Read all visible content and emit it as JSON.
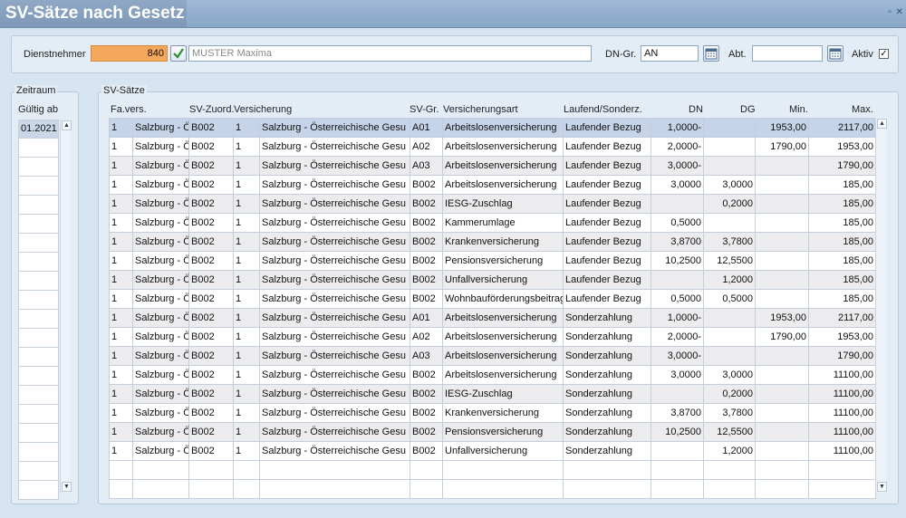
{
  "window": {
    "title": "SV-Sätze nach Gesetz",
    "controls": [
      "▫",
      "✕"
    ]
  },
  "header": {
    "employee_label": "Dienstnehmer",
    "employee_number": "840",
    "employee_name": "MUSTER Maxima",
    "dn_group_label": "DN-Gr.",
    "dn_group_value": "AN",
    "abt_label": "Abt.",
    "abt_value": "",
    "aktiv_label": "Aktiv",
    "aktiv_checked": "✓"
  },
  "zeitraum": {
    "group_label": "Zeitraum",
    "column_header": "Gültig ab",
    "rows": [
      "01.2021",
      "",
      "",
      "",
      "",
      "",
      "",
      "",
      "",
      "",
      "",
      "",
      "",
      "",
      "",
      "",
      "",
      "",
      "",
      ""
    ]
  },
  "sv": {
    "group_label": "SV-Sätze",
    "columns": [
      "Fa.vers.",
      "SV-Zuord.",
      "Versicherung",
      "SV-Gr.",
      "Versicherungsart",
      "Laufend/Sonderz.",
      "DN",
      "DG",
      "Min.",
      "Max."
    ],
    "rows": [
      [
        "1",
        "Salzburg - Öste",
        "B002",
        "1",
        "Salzburg - Österreichische Gesu",
        "A01",
        "Arbeitslosenversicherung",
        "Laufender Bezug",
        "1,0000-",
        "",
        "1953,00",
        "2117,00"
      ],
      [
        "1",
        "Salzburg - Öste",
        "B002",
        "1",
        "Salzburg - Österreichische Gesu",
        "A02",
        "Arbeitslosenversicherung",
        "Laufender Bezug",
        "2,0000-",
        "",
        "1790,00",
        "1953,00"
      ],
      [
        "1",
        "Salzburg - Öste",
        "B002",
        "1",
        "Salzburg - Österreichische Gesu",
        "A03",
        "Arbeitslosenversicherung",
        "Laufender Bezug",
        "3,0000-",
        "",
        "",
        "1790,00"
      ],
      [
        "1",
        "Salzburg - Öste",
        "B002",
        "1",
        "Salzburg - Österreichische Gesu",
        "B002",
        "Arbeitslosenversicherung",
        "Laufender Bezug",
        "3,0000",
        "3,0000",
        "",
        "185,00"
      ],
      [
        "1",
        "Salzburg - Öste",
        "B002",
        "1",
        "Salzburg - Österreichische Gesu",
        "B002",
        "IESG-Zuschlag",
        "Laufender Bezug",
        "",
        "0,2000",
        "",
        "185,00"
      ],
      [
        "1",
        "Salzburg - Öste",
        "B002",
        "1",
        "Salzburg - Österreichische Gesu",
        "B002",
        "Kammerumlage",
        "Laufender Bezug",
        "0,5000",
        "",
        "",
        "185,00"
      ],
      [
        "1",
        "Salzburg - Öste",
        "B002",
        "1",
        "Salzburg - Österreichische Gesu",
        "B002",
        "Krankenversicherung",
        "Laufender Bezug",
        "3,8700",
        "3,7800",
        "",
        "185,00"
      ],
      [
        "1",
        "Salzburg - Öste",
        "B002",
        "1",
        "Salzburg - Österreichische Gesu",
        "B002",
        "Pensionsversicherung",
        "Laufender Bezug",
        "10,2500",
        "12,5500",
        "",
        "185,00"
      ],
      [
        "1",
        "Salzburg - Öste",
        "B002",
        "1",
        "Salzburg - Österreichische Gesu",
        "B002",
        "Unfallversicherung",
        "Laufender Bezug",
        "",
        "1,2000",
        "",
        "185,00"
      ],
      [
        "1",
        "Salzburg - Öste",
        "B002",
        "1",
        "Salzburg - Österreichische Gesu",
        "B002",
        "Wohnbauförderungsbeitrag",
        "Laufender Bezug",
        "0,5000",
        "0,5000",
        "",
        "185,00"
      ],
      [
        "1",
        "Salzburg - Öste",
        "B002",
        "1",
        "Salzburg - Österreichische Gesu",
        "A01",
        "Arbeitslosenversicherung",
        "Sonderzahlung",
        "1,0000-",
        "",
        "1953,00",
        "2117,00"
      ],
      [
        "1",
        "Salzburg - Öste",
        "B002",
        "1",
        "Salzburg - Österreichische Gesu",
        "A02",
        "Arbeitslosenversicherung",
        "Sonderzahlung",
        "2,0000-",
        "",
        "1790,00",
        "1953,00"
      ],
      [
        "1",
        "Salzburg - Öste",
        "B002",
        "1",
        "Salzburg - Österreichische Gesu",
        "A03",
        "Arbeitslosenversicherung",
        "Sonderzahlung",
        "3,0000-",
        "",
        "",
        "1790,00"
      ],
      [
        "1",
        "Salzburg - Öste",
        "B002",
        "1",
        "Salzburg - Österreichische Gesu",
        "B002",
        "Arbeitslosenversicherung",
        "Sonderzahlung",
        "3,0000",
        "3,0000",
        "",
        "11100,00"
      ],
      [
        "1",
        "Salzburg - Öste",
        "B002",
        "1",
        "Salzburg - Österreichische Gesu",
        "B002",
        "IESG-Zuschlag",
        "Sonderzahlung",
        "",
        "0,2000",
        "",
        "11100,00"
      ],
      [
        "1",
        "Salzburg - Öste",
        "B002",
        "1",
        "Salzburg - Österreichische Gesu",
        "B002",
        "Krankenversicherung",
        "Sonderzahlung",
        "3,8700",
        "3,7800",
        "",
        "11100,00"
      ],
      [
        "1",
        "Salzburg - Öste",
        "B002",
        "1",
        "Salzburg - Österreichische Gesu",
        "B002",
        "Pensionsversicherung",
        "Sonderzahlung",
        "10,2500",
        "12,5500",
        "",
        "11100,00"
      ],
      [
        "1",
        "Salzburg - Öste",
        "B002",
        "1",
        "Salzburg - Österreichische Gesu",
        "B002",
        "Unfallversicherung",
        "Sonderzahlung",
        "",
        "1,2000",
        "",
        "11100,00"
      ],
      [
        "",
        "",
        "",
        "",
        "",
        "",
        "",
        "",
        "",
        "",
        "",
        ""
      ],
      [
        "",
        "",
        "",
        "",
        "",
        "",
        "",
        "",
        "",
        "",
        "",
        ""
      ]
    ]
  },
  "colors": {
    "employee_number_bg": "#f5a75c",
    "selected_row": "#c5d4e8",
    "alt_row": "#ececef",
    "title_bar": "#8fa8c6"
  },
  "icons": [
    "calendar-icon",
    "check-icon",
    "scroll-up-icon",
    "scroll-down-icon"
  ]
}
